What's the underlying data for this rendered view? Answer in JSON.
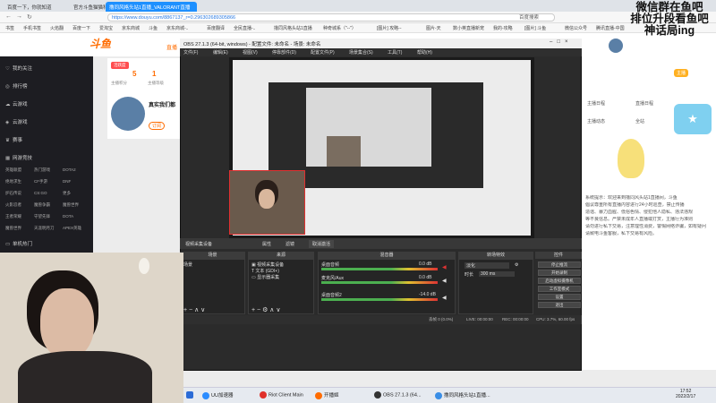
{
  "browser": {
    "tabs": [
      {
        "label": "百度一下，你就知道"
      },
      {
        "label": "官方斗鱼猫猫科技有限公司"
      },
      {
        "label": "撸同风格头站1直播_VALORANT直播"
      }
    ],
    "url": "https://www.douyu.com/8867137_r=0.296302689305866",
    "search_label": "百度搜索",
    "bookmarks": [
      "书签",
      "手机书签",
      "火焰翻",
      "百度一下",
      "爱淘宝",
      "京东商城",
      "斗鱼",
      "京东商城-..",
      "百度翻译",
      "全民直播-..",
      "撸同风格头站1直播",
      "种奇城系（\"--\"）",
      "[图片] 攻略--",
      "图片-天",
      "数小英直播新宠",
      "我的-攻略",
      "[图片] 斗鱼",
      "微信公众号",
      "腾讯直播-中国"
    ]
  },
  "douyu": {
    "logo": "斗鱼",
    "nav_label": "直播",
    "sidebar": [
      "我的关注",
      "排行榜",
      "云游戏",
      "云游戏",
      "赛事",
      "网游竞技"
    ],
    "game_grid": [
      "英雄联盟",
      "热门游戏",
      "DOTA2",
      "绝地求生",
      "CF手游",
      "DNF",
      "炉石传说",
      "CS:GO",
      "更多",
      "火影忍者",
      "魔兽争霸",
      "魔兽世界",
      "王者荣耀",
      "守望先锋",
      "DOTA",
      "魔兽世界",
      "天涯明月刀",
      "APEX英雄"
    ],
    "sidebar_footer": "单机热门",
    "stats": [
      {
        "value": "5",
        "label": "主播积分"
      },
      {
        "value": "1",
        "label": "主播等级"
      }
    ],
    "badge": "活跃度",
    "streamer": "真实我们都",
    "follow": "订阅"
  },
  "obs": {
    "title": "OBS 27.1.3 (64-bit, windows) - 配置文件: 未命名 - 场景: 未命名",
    "menu": [
      "文件(F)",
      "编辑(E)",
      "视图(V)",
      "停靠部件(D)",
      "配置文件(P)",
      "场景集合(S)",
      "工具(T)",
      "帮助(H)"
    ],
    "source_bar": {
      "label": "视频采集设备",
      "properties": "属性",
      "filters": "滤镜",
      "deactivate": "取消激活"
    },
    "docks": {
      "scenes": "场景",
      "sources": "来源",
      "mixer": "混音器",
      "transitions": "转场特效",
      "controls": "控件"
    },
    "scenes": [
      "场景"
    ],
    "sources": [
      "视频采集设备",
      "文本 (GDI+)",
      "显示器采集"
    ],
    "mixer": [
      {
        "name": "桌面音频",
        "level": "0.0 dB"
      },
      {
        "name": "麦克风/Aux",
        "level": "0.0 dB"
      },
      {
        "name": "桌面音频2",
        "level": "-14.0 dB"
      }
    ],
    "transition": {
      "type": "淡化",
      "duration_label": "时长",
      "duration": "300 ms"
    },
    "controls": [
      "停止推流",
      "开始录制",
      "启动虚拟摄像机",
      "工作室模式",
      "设置",
      "退出"
    ],
    "status": {
      "dropped": "丢帧 0 (0.0%)",
      "live": "LIVE: 00:00:00",
      "rec": "REC: 00:00:00",
      "cpu": "CPU: 3.7%, 60.00 fps"
    }
  },
  "overlay_text": [
    "微信群在鱼吧",
    "排位升段看鱼吧",
    "神话局ing"
  ],
  "promo_badge": "主播",
  "right_panel": {
    "labels": [
      "主播日程",
      "直播日程",
      "主播动态",
      "全站"
    ],
    "notice": [
      "系统提示：欢迎来到撸同风头站1直播间，斗鱼",
      "倡议尊重所有直播内容进行24小时巡查，禁止传播",
      "造谣、暴力血腥、低俗色情、侵犯他人隐私、违法违规",
      "等不良信息。严禁未成年人直播或打赏，主播行为准则",
      "请勿进行私下交易，注意理性消费，警惕网络诈骗，如有疑问",
      "请致电斗鱼客服，私下交易有风险。"
    ]
  },
  "taskbar": {
    "items": [
      "UU加速器",
      "Riot Client Main",
      "开播姬",
      "OBS 27.1.3 (64...",
      "撸同风格头站1直播..."
    ],
    "time": "17:52",
    "date": "2022/2/17"
  }
}
